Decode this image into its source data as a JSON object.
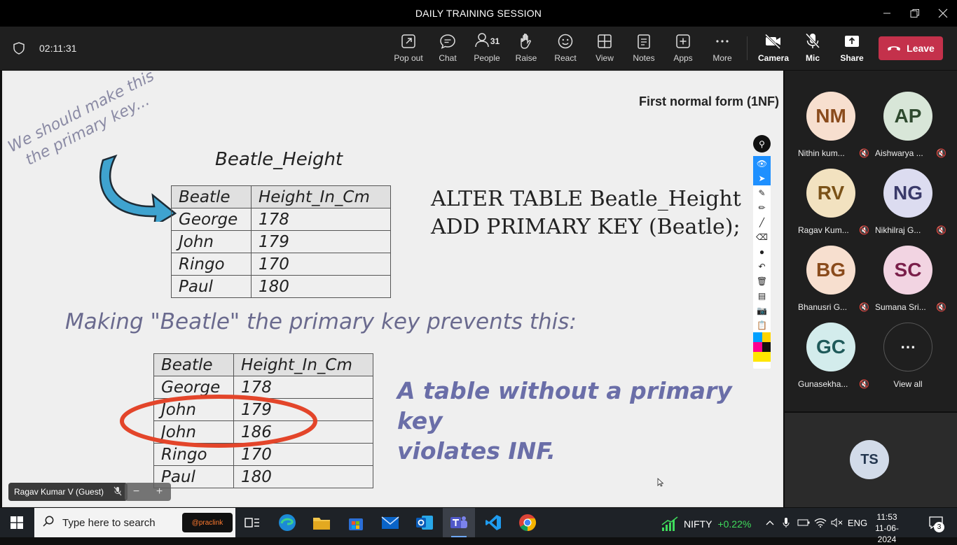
{
  "window": {
    "title": "DAILY TRAINING SESSION"
  },
  "meeting": {
    "timer": "02:11:31",
    "toolbar": [
      {
        "key": "popout",
        "label": "Pop out",
        "icon": "pop-out-icon"
      },
      {
        "key": "chat",
        "label": "Chat",
        "icon": "chat-icon"
      },
      {
        "key": "people",
        "label": "People",
        "icon": "people-icon",
        "count": "31"
      },
      {
        "key": "raise",
        "label": "Raise",
        "icon": "hand-icon"
      },
      {
        "key": "react",
        "label": "React",
        "icon": "smile-icon"
      },
      {
        "key": "view",
        "label": "View",
        "icon": "grid-icon"
      },
      {
        "key": "notes",
        "label": "Notes",
        "icon": "notes-icon"
      },
      {
        "key": "apps",
        "label": "Apps",
        "icon": "plus-square-icon"
      },
      {
        "key": "more",
        "label": "More",
        "icon": "ellipsis-icon"
      }
    ],
    "camera_label": "Camera",
    "mic_label": "Mic",
    "share_label": "Share",
    "leave_label": "Leave",
    "leave_color": "#c4314b"
  },
  "slide": {
    "title": "First normal form (1NF)",
    "note_line1": "We should make this",
    "note_line2": "the primary key...",
    "table_title": "Beatle_Height",
    "table1": {
      "headers": [
        "Beatle",
        "Height_In_Cm"
      ],
      "rows": [
        [
          "George",
          "178"
        ],
        [
          "John",
          "179"
        ],
        [
          "Ringo",
          "170"
        ],
        [
          "Paul",
          "180"
        ]
      ]
    },
    "sql_line1": "ALTER TABLE Beatle_Height",
    "sql_line2": "ADD PRIMARY KEY (Beatle);",
    "prevents": "Making \"Beatle\" the primary key prevents this:",
    "table2": {
      "headers": [
        "Beatle",
        "Height_In_Cm"
      ],
      "rows": [
        [
          "George",
          "178"
        ],
        [
          "John",
          "179"
        ],
        [
          "John",
          "186"
        ],
        [
          "Ringo",
          "170"
        ],
        [
          "Paul",
          "180"
        ]
      ]
    },
    "violates_line1": "A table without a primary key",
    "violates_line2": "violates INF."
  },
  "presenter": {
    "name": "Ragav Kumar V (Guest)"
  },
  "participants": [
    {
      "initials": "NM",
      "name": "Nithin kum...",
      "bg": "#f7dfcf",
      "fg": "#8a4b1c"
    },
    {
      "initials": "AP",
      "name": "Aishwarya ...",
      "bg": "#d8e6d8",
      "fg": "#2f4a2f"
    },
    {
      "initials": "RV",
      "name": "Ragav Kum...",
      "bg": "#f2e2c0",
      "fg": "#7a5218"
    },
    {
      "initials": "NG",
      "name": "Nikhilraj G...",
      "bg": "#dcdcf0",
      "fg": "#3a3a6a"
    },
    {
      "initials": "BG",
      "name": "Bhanusri G...",
      "bg": "#f7dfcf",
      "fg": "#8a4b1c"
    },
    {
      "initials": "SC",
      "name": "Sumana Sri...",
      "bg": "#f2d4e2",
      "fg": "#7a1f4a"
    },
    {
      "initials": "GC",
      "name": "Gunasekha...",
      "bg": "#d3ecec",
      "fg": "#1f5a5a"
    }
  ],
  "view_all_label": "View all",
  "self_initials": "TS",
  "taskbar": {
    "search_placeholder": "Type here to search",
    "promo_text": "@praclink",
    "nifty_label": "NIFTY",
    "nifty_change": "+0.22%",
    "lang": "ENG",
    "time": "11:53",
    "date": "11-06-2024",
    "notif_count": "3"
  }
}
